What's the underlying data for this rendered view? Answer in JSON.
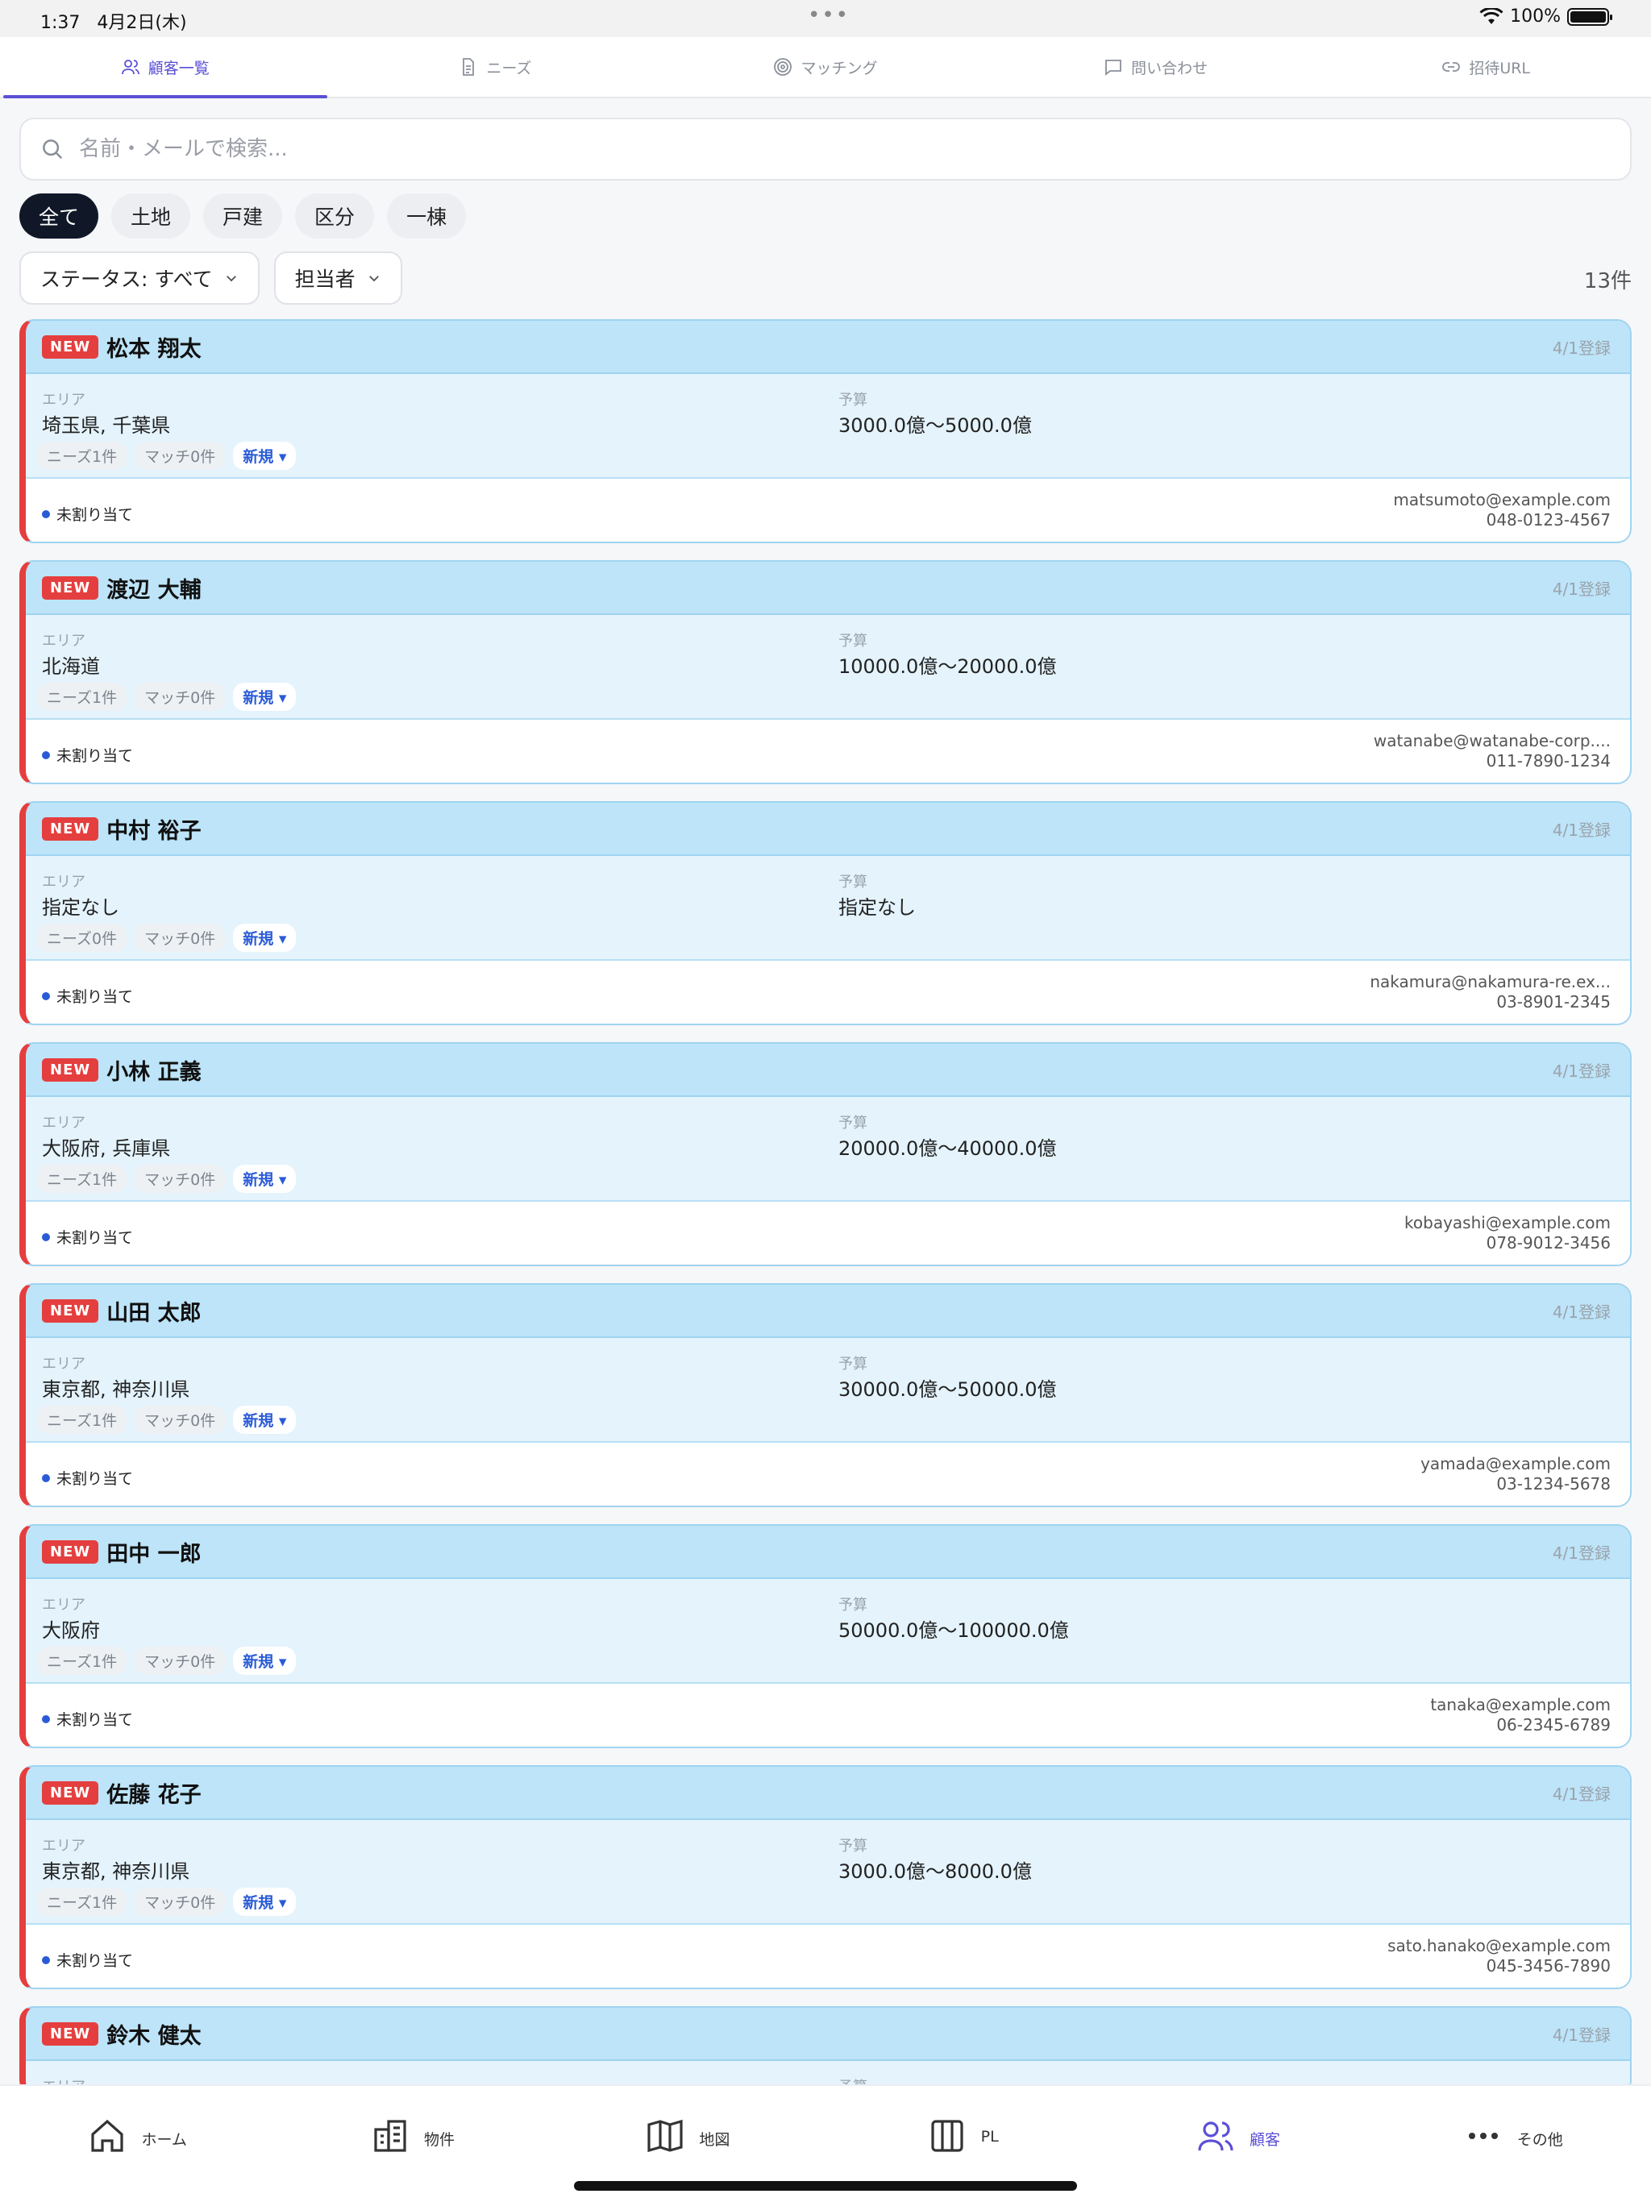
{
  "status": {
    "time": "1:37",
    "date": "4月2日(木)",
    "battery": "100%"
  },
  "tabs": [
    {
      "label": "顧客一覧",
      "icon": "users-icon"
    },
    {
      "label": "ニーズ",
      "icon": "document-icon"
    },
    {
      "label": "マッチング",
      "icon": "target-icon"
    },
    {
      "label": "問い合わせ",
      "icon": "chat-icon"
    },
    {
      "label": "招待URL",
      "icon": "link-icon"
    }
  ],
  "search": {
    "placeholder": "名前・メールで検索..."
  },
  "chips": [
    "全て",
    "土地",
    "戸建",
    "区分",
    "一棟"
  ],
  "filters": {
    "status": "ステータス: すべて",
    "owner": "担当者"
  },
  "count": "13件",
  "labels": {
    "new": "NEW",
    "area": "エリア",
    "budget": "予算",
    "unassigned": "未割り当て",
    "stage": "新規 ▾"
  },
  "customers": [
    {
      "name": "松本 翔太",
      "registered": "4/1登録",
      "area": "埼玉県, 千葉県",
      "budget": "3000.0億〜5000.0億",
      "needs": "ニーズ1件",
      "matches": "マッチ0件",
      "email": "matsumoto@example.com",
      "phone": "048-0123-4567"
    },
    {
      "name": "渡辺 大輔",
      "registered": "4/1登録",
      "area": "北海道",
      "budget": "10000.0億〜20000.0億",
      "needs": "ニーズ1件",
      "matches": "マッチ0件",
      "email": "watanabe@watanabe-corp....",
      "phone": "011-7890-1234"
    },
    {
      "name": "中村 裕子",
      "registered": "4/1登録",
      "area": "指定なし",
      "budget": "指定なし",
      "needs": "ニーズ0件",
      "matches": "マッチ0件",
      "email": "nakamura@nakamura-re.ex...",
      "phone": "03-8901-2345"
    },
    {
      "name": "小林 正義",
      "registered": "4/1登録",
      "area": "大阪府, 兵庫県",
      "budget": "20000.0億〜40000.0億",
      "needs": "ニーズ1件",
      "matches": "マッチ0件",
      "email": "kobayashi@example.com",
      "phone": "078-9012-3456"
    },
    {
      "name": "山田 太郎",
      "registered": "4/1登録",
      "area": "東京都, 神奈川県",
      "budget": "30000.0億〜50000.0億",
      "needs": "ニーズ1件",
      "matches": "マッチ0件",
      "email": "yamada@example.com",
      "phone": "03-1234-5678"
    },
    {
      "name": "田中 一郎",
      "registered": "4/1登録",
      "area": "大阪府",
      "budget": "50000.0億〜100000.0億",
      "needs": "ニーズ1件",
      "matches": "マッチ0件",
      "email": "tanaka@example.com",
      "phone": "06-2345-6789"
    },
    {
      "name": "佐藤 花子",
      "registered": "4/1登録",
      "area": "東京都, 神奈川県",
      "budget": "3000.0億〜8000.0億",
      "needs": "ニーズ1件",
      "matches": "マッチ0件",
      "email": "sato.hanako@example.com",
      "phone": "045-3456-7890"
    }
  ],
  "partial": {
    "name": "鈴木 健太",
    "registered": "4/1登録"
  },
  "nav": [
    {
      "label": "ホーム",
      "icon": "home-icon"
    },
    {
      "label": "物件",
      "icon": "building-icon"
    },
    {
      "label": "地図",
      "icon": "map-icon"
    },
    {
      "label": "PL",
      "icon": "columns-icon"
    },
    {
      "label": "顧客",
      "icon": "users-icon"
    },
    {
      "label": "その他",
      "icon": "more-icon"
    }
  ]
}
